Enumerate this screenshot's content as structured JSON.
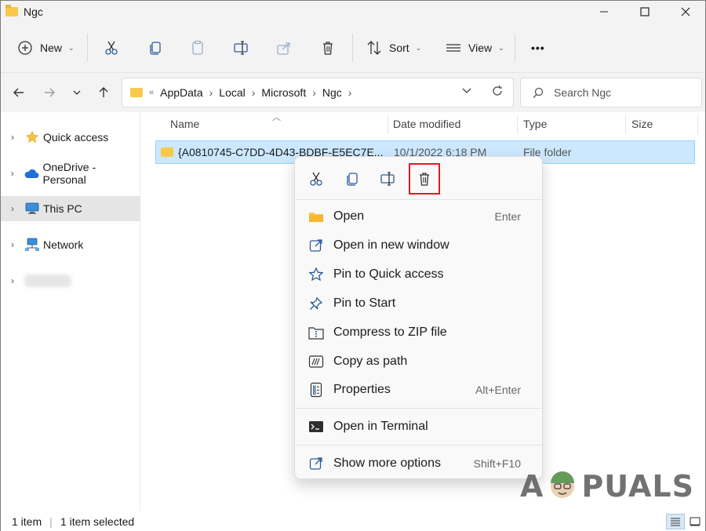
{
  "window": {
    "title": "Ngc"
  },
  "toolbar": {
    "new_label": "New",
    "sort_label": "Sort",
    "view_label": "View",
    "more_label": "•••"
  },
  "address": {
    "prefix": "«",
    "crumbs": [
      "AppData",
      "Local",
      "Microsoft",
      "Ngc"
    ],
    "search_placeholder": "Search Ngc"
  },
  "nav": {
    "items": [
      {
        "label": "Quick access",
        "icon": "star-icon"
      },
      {
        "label": "OneDrive - Personal",
        "icon": "cloud-icon"
      },
      {
        "label": "This PC",
        "icon": "monitor-icon",
        "selected": true
      },
      {
        "label": "Network",
        "icon": "network-icon"
      },
      {
        "label": "",
        "icon": "blurred-item"
      }
    ]
  },
  "columns": {
    "name": "Name",
    "date": "Date modified",
    "type": "Type",
    "size": "Size"
  },
  "files": [
    {
      "name": "{A0810745-C7DD-4D43-BDBF-E5EC7E...",
      "date": "10/1/2022 6:18 PM",
      "type": "File folder"
    }
  ],
  "status": {
    "count": "1 item",
    "selected": "1 item selected"
  },
  "context_menu": {
    "quick_actions": [
      "cut-icon",
      "copy-icon",
      "rename-icon",
      "delete-icon"
    ],
    "highlighted_action": "delete-icon",
    "items": [
      {
        "label": "Open",
        "shortcut": "Enter",
        "icon": "folder-icon"
      },
      {
        "label": "Open in new window",
        "shortcut": "",
        "icon": "open-external-icon"
      },
      {
        "label": "Pin to Quick access",
        "shortcut": "",
        "icon": "star-outline-icon"
      },
      {
        "label": "Pin to Start",
        "shortcut": "",
        "icon": "pin-icon"
      },
      {
        "label": "Compress to ZIP file",
        "shortcut": "",
        "icon": "zip-icon"
      },
      {
        "label": "Copy as path",
        "shortcut": "",
        "icon": "copy-path-icon"
      },
      {
        "label": "Properties",
        "shortcut": "Alt+Enter",
        "icon": "properties-icon"
      },
      {
        "label": "Open in Terminal",
        "shortcut": "",
        "icon": "terminal-icon"
      },
      {
        "label": "Show more options",
        "shortcut": "Shift+F10",
        "icon": "more-options-icon"
      }
    ]
  },
  "watermark": {
    "left": "A",
    "right": "PUALS"
  }
}
